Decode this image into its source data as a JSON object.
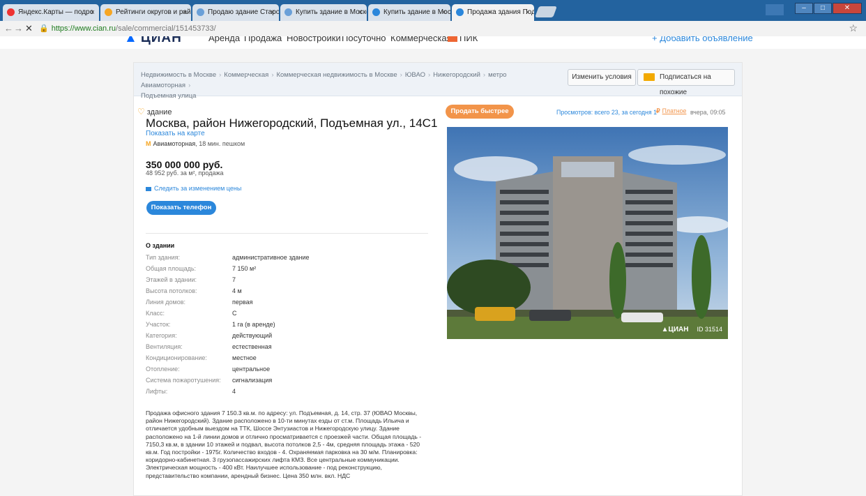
{
  "browser": {
    "tabs": [
      {
        "label": "Яндекс.Карты — подро",
        "icon_color": "#e33"
      },
      {
        "label": "Рейтинги округов и рай",
        "icon_color": "#f6a623"
      },
      {
        "label": "Продаю здание Старо",
        "icon_color": "#6aa0d8"
      },
      {
        "label": "Купить здание в Моско",
        "icon_color": "#6aa0d8"
      },
      {
        "label": "Купить здание в Моско",
        "icon_color": "#2b87db"
      },
      {
        "label": "Продажа здания Подъе",
        "icon_color": "#2b87db"
      }
    ],
    "url_host": "https://www.cian.ru",
    "url_path": "/sale/commercial/151453733/"
  },
  "site_nav": {
    "logo": "ЦИАН",
    "links": [
      "Аренда",
      "Продажа",
      "Новостройки",
      "Посуточно",
      "Коммерческая",
      "ПИК"
    ],
    "add": "+ Добавить объявление"
  },
  "breadcrumbs": [
    "Недвижимость в Москве",
    "Коммерческая",
    "Коммерческая недвижимость в Москве",
    "ЮВАО",
    "Нижегородский",
    "метро Авиамоторная",
    "Подъемная улица"
  ],
  "actions": {
    "change": "Изменить условия",
    "subscribe": "Подписаться на похожие"
  },
  "listing": {
    "type": "здание",
    "title": "Москва, район Нижегородский, Подъемная ул., 14С1",
    "map_link": "Показать на карте",
    "metro_station": "Авиамоторная",
    "metro_walk": ", 18 мин. пешком",
    "price": "350 000 000 руб.",
    "price_per_m2": "48 952 руб. за м², продажа",
    "follow": "Следить за изменением цены",
    "phone_button": "Показать телефон"
  },
  "about": {
    "heading": "О здании",
    "props": [
      {
        "k": "Тип здания:",
        "v": "административное здание"
      },
      {
        "k": "Общая площадь:",
        "v": "7 150 м²"
      },
      {
        "k": "Этажей в здании:",
        "v": "7"
      },
      {
        "k": "Высота потолков:",
        "v": "4 м"
      },
      {
        "k": "Линия домов:",
        "v": "первая"
      },
      {
        "k": "Класс:",
        "v": "C"
      },
      {
        "k": "Участок:",
        "v": "1 га (в аренде)"
      },
      {
        "k": "Категория:",
        "v": "действующий"
      },
      {
        "k": "Вентиляция:",
        "v": "естественная"
      },
      {
        "k": "Кондиционирование:",
        "v": "местное"
      },
      {
        "k": "Отопление:",
        "v": "центральное"
      },
      {
        "k": "Система пожаротушения:",
        "v": "сигнализация"
      },
      {
        "k": "Лифты:",
        "v": "4"
      }
    ]
  },
  "description": "Продажа офисного здания 7 150.3 кв.м. по адресу: ул. Подъемная, д. 14, стр. 37 (ЮВАО Москвы, район Нижегородский). Здание расположено в 10-ти минутах езды от ст.м. Площадь Ильича и отличается удобным выездом на ТТК, Шоссе Энтузиастов и Нижегородскую улицу. Здание расположено на 1-й линии домов и отлично просматривается с проезжей части. Общая площадь - 7150,3 кв.м, в здании 10 этажей и подвал, высота потолков 2,5 - 4м, средняя площадь этажа - 520 кв.м. Год постройки - 1975г. Количество входов - 4. Охраняемая парковка на 30 м/м. Планировка: коридорно-кабинетная. 3 грузопассажирских лифта КМЗ. Все центральные коммуникации. Электрическая мощность - 400 кВт. Наилучшее использование - под реконструкцию, представительство компании, арендный бизнес. Цена 350 млн. вкл. НДС",
  "meta": {
    "sell_faster": "Продать быстрее",
    "views": "Просмотров: всего 23, за сегодня 1",
    "paid": "Платное",
    "date": "вчера, 09:05"
  },
  "photo": {
    "watermark_logo": "ЦИАН",
    "watermark_id": "ID 31514"
  }
}
